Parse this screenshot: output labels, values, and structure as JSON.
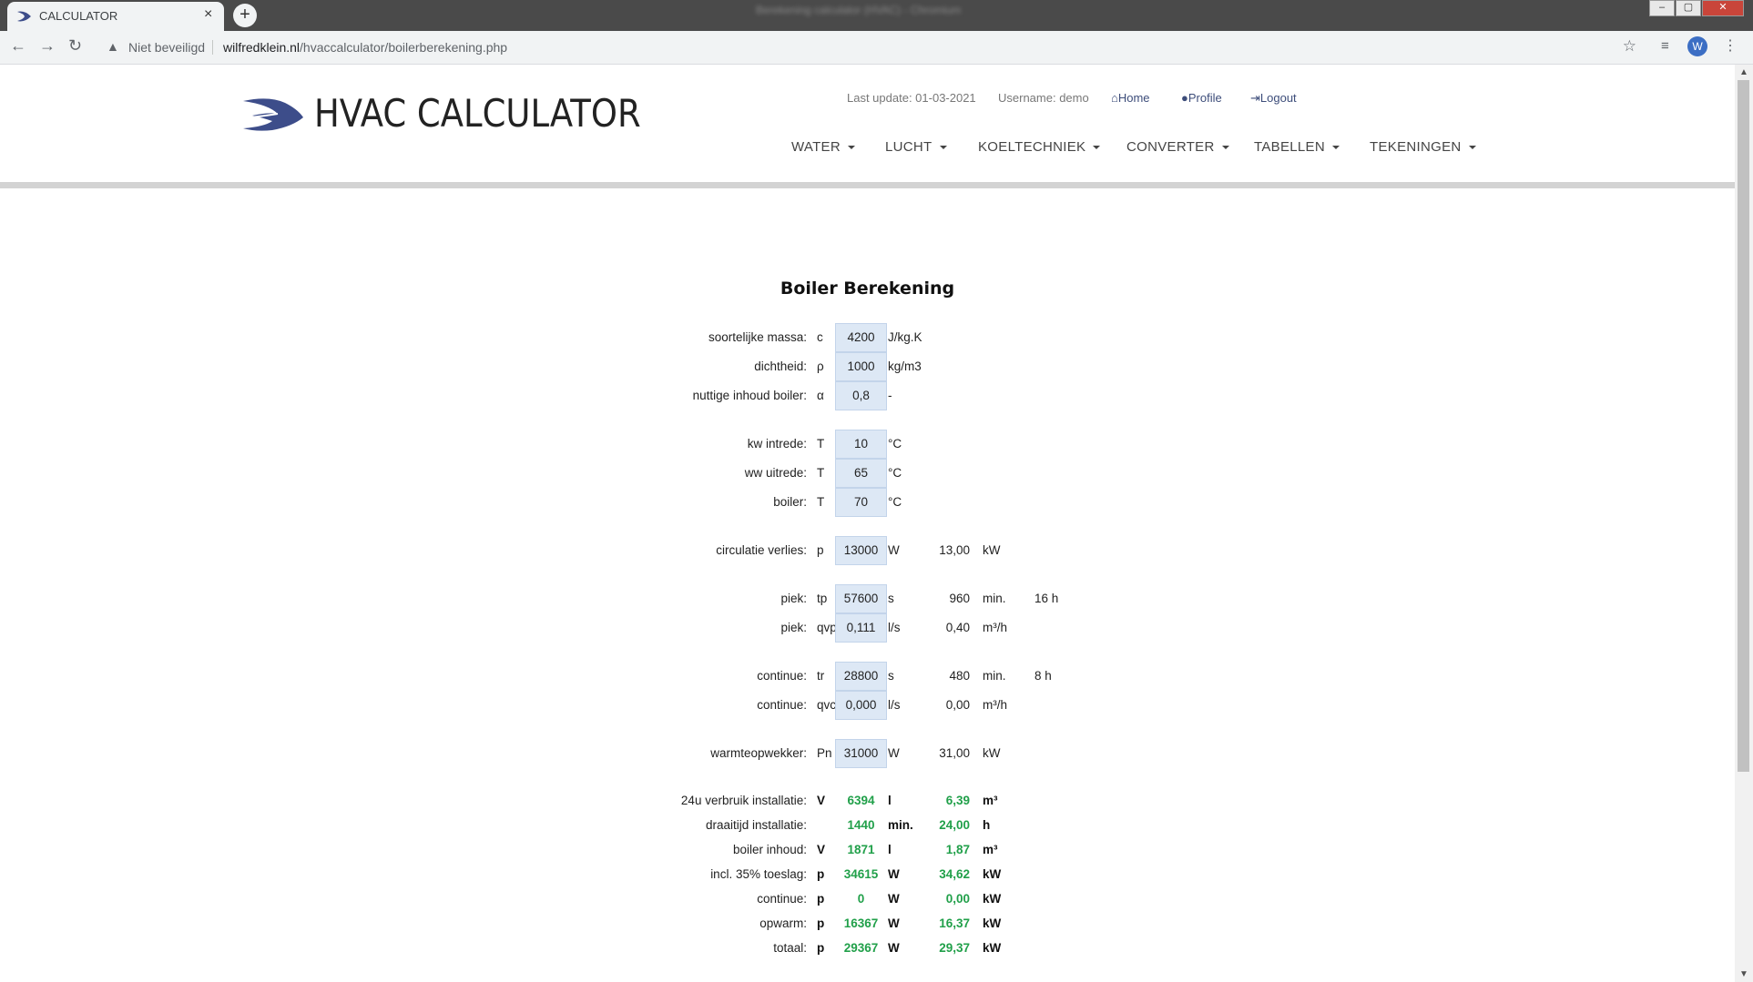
{
  "browser": {
    "tab_title": "CALCULATOR",
    "tab_close": "×",
    "new_tab": "+",
    "window_title": "Berekening calculator (HVAC) - Chromium",
    "window_controls": [
      "–",
      "▢",
      "✕"
    ],
    "security_label": "Niet beveiligd",
    "url_domain": "wilfredklein.nl",
    "url_path": "/hvaccalculator/boilerberekening.php",
    "avatar_initial": "W"
  },
  "header": {
    "logo_text": "HVAC CALCULATOR",
    "last_update": "Last update: 01-03-2021",
    "username": "Username: demo",
    "home": "Home",
    "profile": "Profile",
    "logout": "Logout",
    "nav": [
      "WATER",
      "LUCHT",
      "KOELTECHNIEK",
      "CONVERTER",
      "TABELLEN",
      "TEKENINGEN"
    ]
  },
  "calculator": {
    "title": "Boiler Berekening",
    "inputs": [
      {
        "label": "soortelijke massa:",
        "symbol": "c",
        "value": "4200",
        "unit": "J/kg.K"
      },
      {
        "label": "dichtheid:",
        "symbol": "ρ",
        "value": "1000",
        "unit": "kg/m3"
      },
      {
        "label": "nuttige inhoud boiler:",
        "symbol": "α",
        "value": "0,8",
        "unit": "-"
      },
      {
        "label": "kw intrede:",
        "symbol": "T",
        "value": "10",
        "unit": "°C"
      },
      {
        "label": "ww uitrede:",
        "symbol": "T",
        "value": "65",
        "unit": "°C"
      },
      {
        "label": "boiler:",
        "symbol": "T",
        "value": "70",
        "unit": "°C"
      },
      {
        "label": "circulatie verlies:",
        "symbol": "p",
        "value": "13000",
        "unit": "W",
        "value2": "13,00",
        "unit2": "kW"
      },
      {
        "label": "piek:",
        "symbol": "tp",
        "value": "57600",
        "unit": "s",
        "value2": "960",
        "unit2": "min.",
        "value3": "16 h"
      },
      {
        "label": "piek:",
        "symbol": "qvp",
        "value": "0,111",
        "unit": "l/s",
        "value2": "0,40",
        "unit2": "m³/h"
      },
      {
        "label": "continue:",
        "symbol": "tr",
        "value": "28800",
        "unit": "s",
        "value2": "480",
        "unit2": "min.",
        "value3": "8 h"
      },
      {
        "label": "continue:",
        "symbol": "qvc",
        "value": "0,000",
        "unit": "l/s",
        "value2": "0,00",
        "unit2": "m³/h"
      },
      {
        "label": "warmteopwekker:",
        "symbol": "Pn",
        "value": "31000",
        "unit": "W",
        "value2": "31,00",
        "unit2": "kW"
      }
    ],
    "results": [
      {
        "label": "24u verbruik installatie:",
        "symbol": "V",
        "value": "6394",
        "unit": "l",
        "value2": "6,39",
        "unit2": "m³"
      },
      {
        "label": "draaitijd installatie:",
        "symbol": "",
        "value": "1440",
        "unit": "min.",
        "value2": "24,00",
        "unit2": "h"
      },
      {
        "label": "boiler inhoud:",
        "symbol": "V",
        "value": "1871",
        "unit": "l",
        "value2": "1,87",
        "unit2": "m³"
      },
      {
        "label": "incl. 35% toeslag:",
        "symbol": "p",
        "value": "34615",
        "unit": "W",
        "value2": "34,62",
        "unit2": "kW"
      },
      {
        "label": "continue:",
        "symbol": "p",
        "value": "0",
        "unit": "W",
        "value2": "0,00",
        "unit2": "kW"
      },
      {
        "label": "opwarm:",
        "symbol": "p",
        "value": "16367",
        "unit": "W",
        "value2": "16,37",
        "unit2": "kW"
      },
      {
        "label": "totaal:",
        "symbol": "p",
        "value": "29367",
        "unit": "W",
        "value2": "29,37",
        "unit2": "kW"
      }
    ]
  },
  "icons": {
    "back": "←",
    "forward": "→",
    "reload": "↻",
    "warning": "▲",
    "star": "☆",
    "ext": "≡",
    "menu": "⋮",
    "home": "⌂",
    "scroll_up": "▲",
    "scroll_down": "▼"
  },
  "colors": {
    "result_green": "#21a04a",
    "input_bg": "#dde8f5",
    "logo_blue": "#3d4d8a"
  }
}
